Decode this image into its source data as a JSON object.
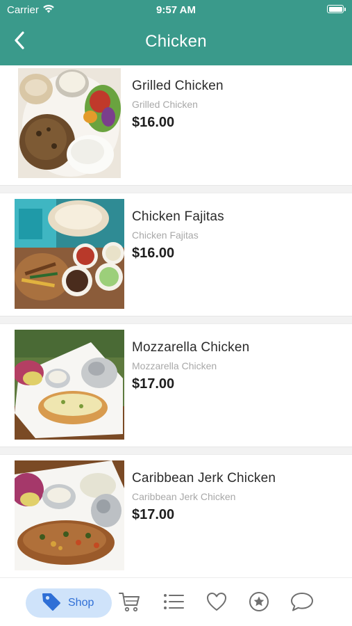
{
  "status_bar": {
    "carrier": "Carrier",
    "time": "9:57 AM"
  },
  "header": {
    "title": "Chicken",
    "back_icon": "chevron-left-icon",
    "background": "#3a9a8b"
  },
  "products": [
    {
      "name": "Grilled Chicken",
      "description": "Grilled Chicken",
      "price": "$16.00"
    },
    {
      "name": "Chicken Fajitas",
      "description": "Chicken Fajitas",
      "price": "$16.00"
    },
    {
      "name": "Mozzarella Chicken",
      "description": "Mozzarella Chicken",
      "price": "$17.00"
    },
    {
      "name": "Caribbean Jerk Chicken",
      "description": "Caribbean Jerk Chicken",
      "price": "$17.00"
    }
  ],
  "tab_bar": {
    "active_tab": "Shop",
    "shop_label": "Shop",
    "icons": [
      "tag-icon",
      "cart-icon",
      "list-icon",
      "heart-icon",
      "star-icon",
      "chat-bubble-icon"
    ],
    "active_color": "#2f6fd6",
    "active_background": "#cfe3fa",
    "icon_color": "#6f6f6f"
  }
}
